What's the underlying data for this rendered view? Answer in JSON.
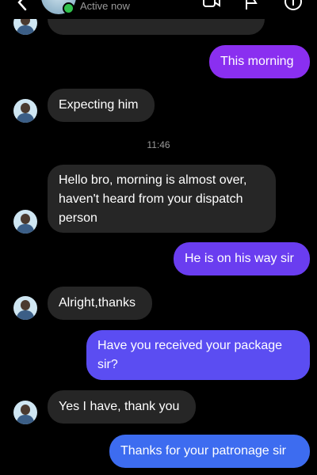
{
  "header": {
    "status": "Active now"
  },
  "chat": {
    "clipped_text": "dispatch",
    "messages": {
      "m1": "This morning",
      "m2": "Expecting him",
      "ts": "11:46",
      "m3": "Hello bro, morning is almost over, haven't heard from your dispatch person",
      "m4": "He is on his way sir",
      "m5": "Alright,thanks",
      "m6": "Have you received your package sir?",
      "m7": "Yes I have, thank you",
      "m8": "Thanks for your patronage sir"
    }
  },
  "colors": {
    "incoming_bubble": "#262626",
    "outgoing_purple": "#8a2ff0",
    "outgoing_indigo": "#5b4df2",
    "outgoing_blue": "#3d6cf0",
    "online": "#31c24d"
  },
  "icons": [
    "back-arrow-icon",
    "video-call-icon",
    "flag-icon",
    "info-icon"
  ]
}
